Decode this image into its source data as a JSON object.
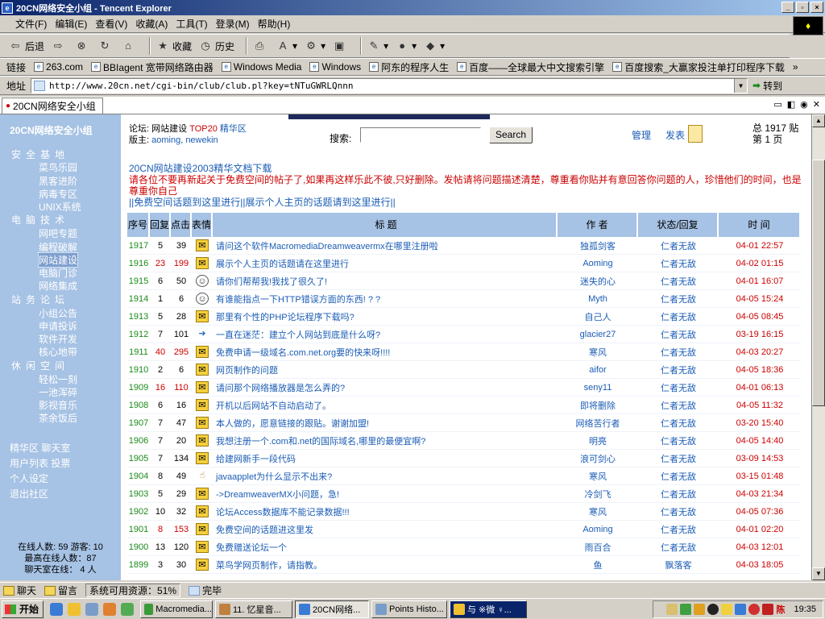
{
  "window": {
    "title": "20CN网络安全小组 - Tencent Explorer"
  },
  "menu": [
    "文件(F)",
    "编辑(E)",
    "查看(V)",
    "收藏(A)",
    "工具(T)",
    "登录(M)",
    "帮助(H)"
  ],
  "toolbar": {
    "back": "后退",
    "favorites": "收藏",
    "history": "历史"
  },
  "links_label": "链接",
  "links": [
    "263.com",
    "BBIagent 宽带网络路由器",
    "Windows Media",
    "Windows",
    "阿东的程序人生",
    "百度——全球最大中文搜索引擎",
    "百度搜索_大赢家投注单打印程序下载"
  ],
  "address": {
    "label": "地址",
    "url": "http://www.20cn.net/cgi-bin/club/club.pl?key=tNTuGWRLQnnn",
    "go": "转到"
  },
  "tab": {
    "label": "20CN网络安全小组"
  },
  "sidebar": {
    "logo": "20CN网络安全小组",
    "sections": [
      {
        "title": "安全基地",
        "items": [
          "菜鸟乐园",
          "黑客进阶",
          "病毒专区",
          "UNIX系统"
        ]
      },
      {
        "title": "电脑技术",
        "items": [
          "网吧专题",
          "编程破解",
          "网站建设",
          "电脑门诊",
          "网络集成"
        ]
      },
      {
        "title": "站务论坛",
        "items": [
          "小组公告",
          "申请投诉",
          "软件开发",
          "核心地带"
        ]
      },
      {
        "title": "休闲空间",
        "items": [
          "轻松一刻",
          "一池浑碎",
          "影视音乐",
          "茶余饭后"
        ]
      }
    ],
    "selected_item": "网站建设",
    "links": [
      "精华区  聊天室",
      "用户列表 投票",
      "个人设定",
      "退出社区"
    ],
    "stats": {
      "online": "在线人数: 59 游客: 10",
      "max": "最高在线人数：87",
      "chat": "聊天室在线： 4 人"
    }
  },
  "forum": {
    "forum_label": "论坛:",
    "forum_name": "网站建设",
    "top20": "TOP20",
    "elite": "精华区",
    "mods_label": "版主:",
    "mods": "aoming, newekin",
    "search_label": "搜索:",
    "search_value": "",
    "search_button": "Search",
    "manage": "管理",
    "post": "发表",
    "total": "总 1917 贴",
    "page": "第 1 页",
    "notice1": "20CN网站建设2003精华文档下载",
    "notice2": "请各位不要再新起关于免费空间的帖子了,如果再这样乐此不彼,只好删除。发帖请将问题描述清楚，尊重看你贴并有意回答你问题的人，珍惜他们的时间，也是尊重你自己",
    "notice3": "||免费空间话题到这里进行||展示个人主页的话题请到这里进行||"
  },
  "table": {
    "headers": [
      "序号",
      "回复",
      "点击",
      "表情",
      "标 题",
      "作 者",
      "状态/回复",
      "时 间"
    ],
    "rows": [
      {
        "id": "1917",
        "replies": "5",
        "clicks": "39",
        "hot": false,
        "icon": "folder",
        "title": "请问这个软件MacromediaDreamweavermx在哪里注册啦",
        "author": "独孤剑客",
        "status": "仁者无敌",
        "time": "04-01 22:57"
      },
      {
        "id": "1916",
        "replies": "23",
        "clicks": "199",
        "hot": true,
        "icon": "folder",
        "title": "展示个人主页的话题请在这里进行",
        "author": "Aoming",
        "status": "仁者无敌",
        "time": "04-02 01:15"
      },
      {
        "id": "1915",
        "replies": "6",
        "clicks": "50",
        "hot": false,
        "icon": "face",
        "title": "请你们帮帮我!我找了很久了!",
        "author": "迷失的心",
        "status": "仁者无敌",
        "time": "04-01 16:07"
      },
      {
        "id": "1914",
        "replies": "1",
        "clicks": "6",
        "hot": false,
        "icon": "face",
        "title": "有谁能指点一下HTTP错误方面的东西! ? ?",
        "author": "Myth",
        "status": "仁者无敌",
        "time": "04-05 15:24"
      },
      {
        "id": "1913",
        "replies": "5",
        "clicks": "28",
        "hot": false,
        "icon": "folder",
        "title": "那里有个性的PHP论坛程序下载吗?",
        "author": "自己人",
        "status": "仁者无敌",
        "time": "04-05 08:45"
      },
      {
        "id": "1912",
        "replies": "7",
        "clicks": "101",
        "hot": false,
        "icon": "arrow",
        "title": "一直在迷茫：建立个人网站到底是什么呀?",
        "author": "glacier27",
        "status": "仁者无敌",
        "time": "03-19 16:15"
      },
      {
        "id": "1911",
        "replies": "40",
        "clicks": "295",
        "hot": true,
        "icon": "folder",
        "title": "免费申请一级域名.com.net.org要的快来呀!!!!",
        "author": "寒风",
        "status": "仁者无敌",
        "time": "04-03 20:27"
      },
      {
        "id": "1910",
        "replies": "2",
        "clicks": "6",
        "hot": false,
        "icon": "folder",
        "title": "网页制作的问题",
        "author": "aifor",
        "status": "仁者无敌",
        "time": "04-05 18:36"
      },
      {
        "id": "1909",
        "replies": "16",
        "clicks": "110",
        "hot": true,
        "icon": "folder",
        "title": "请问那个网络播放器是怎么弄的?",
        "author": "seny11",
        "status": "仁者无敌",
        "time": "04-01 06:13"
      },
      {
        "id": "1908",
        "replies": "6",
        "clicks": "16",
        "hot": false,
        "icon": "folder",
        "title": "开机以后网站不自动启动了。",
        "author": "即将删除",
        "status": "仁者无敌",
        "time": "04-05 11:32"
      },
      {
        "id": "1907",
        "replies": "7",
        "clicks": "47",
        "hot": false,
        "icon": "folder",
        "title": "本人做的，愿意链接的跟贴。谢谢加盟!",
        "author": "网络苦行者",
        "status": "仁者无敌",
        "time": "03-20 15:40"
      },
      {
        "id": "1906",
        "replies": "7",
        "clicks": "20",
        "hot": false,
        "icon": "folder",
        "title": "我想注册一个.com和.net的国际域名,哪里的最便宜啊?",
        "author": "明亮",
        "status": "仁者无敌",
        "time": "04-05 14:40"
      },
      {
        "id": "1905",
        "replies": "7",
        "clicks": "134",
        "hot": false,
        "icon": "folder",
        "title": "给建网新手一段代码",
        "author": "浪可剑心",
        "status": "仁者无敌",
        "time": "03-09 14:53"
      },
      {
        "id": "1904",
        "replies": "8",
        "clicks": "49",
        "hot": false,
        "icon": "hand",
        "title": "javaapplet为什么显示不出来?",
        "author": "寒风",
        "status": "仁者无敌",
        "time": "03-15 01:48"
      },
      {
        "id": "1903",
        "replies": "5",
        "clicks": "29",
        "hot": false,
        "icon": "folder",
        "title": "->DreamweaverMX小问题，急!",
        "author": "冷剑飞",
        "status": "仁者无敌",
        "time": "04-03 21:34"
      },
      {
        "id": "1902",
        "replies": "10",
        "clicks": "32",
        "hot": false,
        "icon": "folder",
        "title": "论坛Access数据库不能记录数据!!!",
        "author": "寒风",
        "status": "仁者无敌",
        "time": "04-05 07:36"
      },
      {
        "id": "1901",
        "replies": "8",
        "clicks": "153",
        "hot": true,
        "icon": "folder",
        "title": "免费空间的话题进这里发",
        "author": "Aoming",
        "status": "仁者无敌",
        "time": "04-01 02:20"
      },
      {
        "id": "1900",
        "replies": "13",
        "clicks": "120",
        "hot": false,
        "icon": "folder",
        "title": "免费赠送论坛一个",
        "author": "雨百合",
        "status": "仁者无敌",
        "time": "04-03 12:01"
      },
      {
        "id": "1899",
        "replies": "3",
        "clicks": "30",
        "hot": false,
        "icon": "folder",
        "title": "菜鸟学网页制作，请指教。",
        "author": "鱼",
        "status": "飘落客",
        "time": "04-03 18:05"
      }
    ]
  },
  "statusbar": {
    "chat": "聊天",
    "msg": "留言",
    "resources": "系统可用资源：51%",
    "done": "完毕"
  },
  "taskbar": {
    "start": "开始",
    "tasks": [
      "Macromedia...",
      "11. 忆星音...",
      "20CN网络...",
      "Points Histo...",
      "与 ※微 ♀..."
    ],
    "tray_text": "陈",
    "clock": "19:35"
  }
}
